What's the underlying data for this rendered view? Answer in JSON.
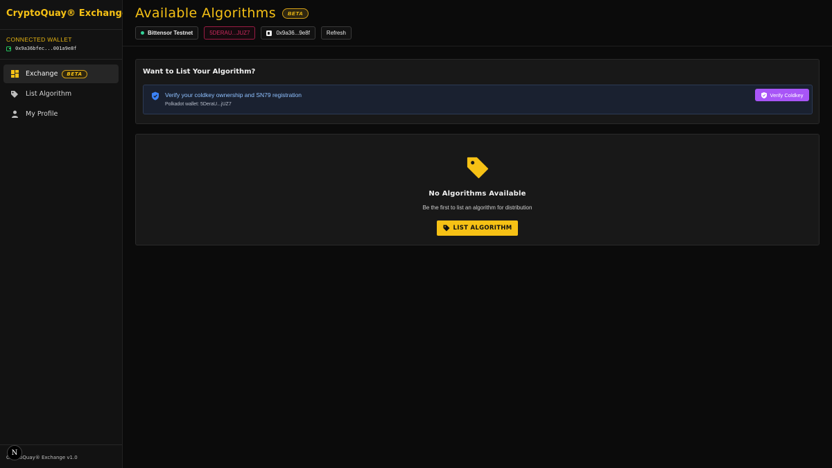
{
  "sidebar": {
    "brand": "CryptoQuay® Exchange",
    "wallet_label": "CONNECTED WALLET",
    "wallet_address": "0x9a36bfec...001a9e8f",
    "nav": [
      {
        "label": "Exchange",
        "badge": "BETA",
        "icon": "grid-icon",
        "active": true
      },
      {
        "label": "List Algorithm",
        "icon": "tag-icon",
        "active": false
      },
      {
        "label": "My Profile",
        "icon": "user-icon",
        "active": false
      }
    ],
    "footer": "CryptoQuay® Exchange v1.0",
    "next_badge": "N"
  },
  "header": {
    "title": "Available Algorithms",
    "beta": "BETA",
    "network": "Bittensor Testnet",
    "polkadot_account": "5DERAU...JUZ7",
    "evm_account": "0x9a36...9e8f",
    "refresh": "Refresh"
  },
  "list_card": {
    "heading": "Want to List Your Algorithm?",
    "verify_text": "Verify your coldkey ownership and SN79 registration",
    "verify_sub": "Polkadot wallet: 5DeraU...jUZ7",
    "verify_button": "Verify Coldkey"
  },
  "empty_state": {
    "title": "No Algorithms Available",
    "subtitle": "Be the first to list an algorithm for distribution",
    "button": "LIST ALGORITHM"
  },
  "colors": {
    "accent": "#f6c115",
    "verify_purple": "#a855f7",
    "network_dot": "#34d399",
    "polkadot_pink": "#cc2a5e"
  }
}
